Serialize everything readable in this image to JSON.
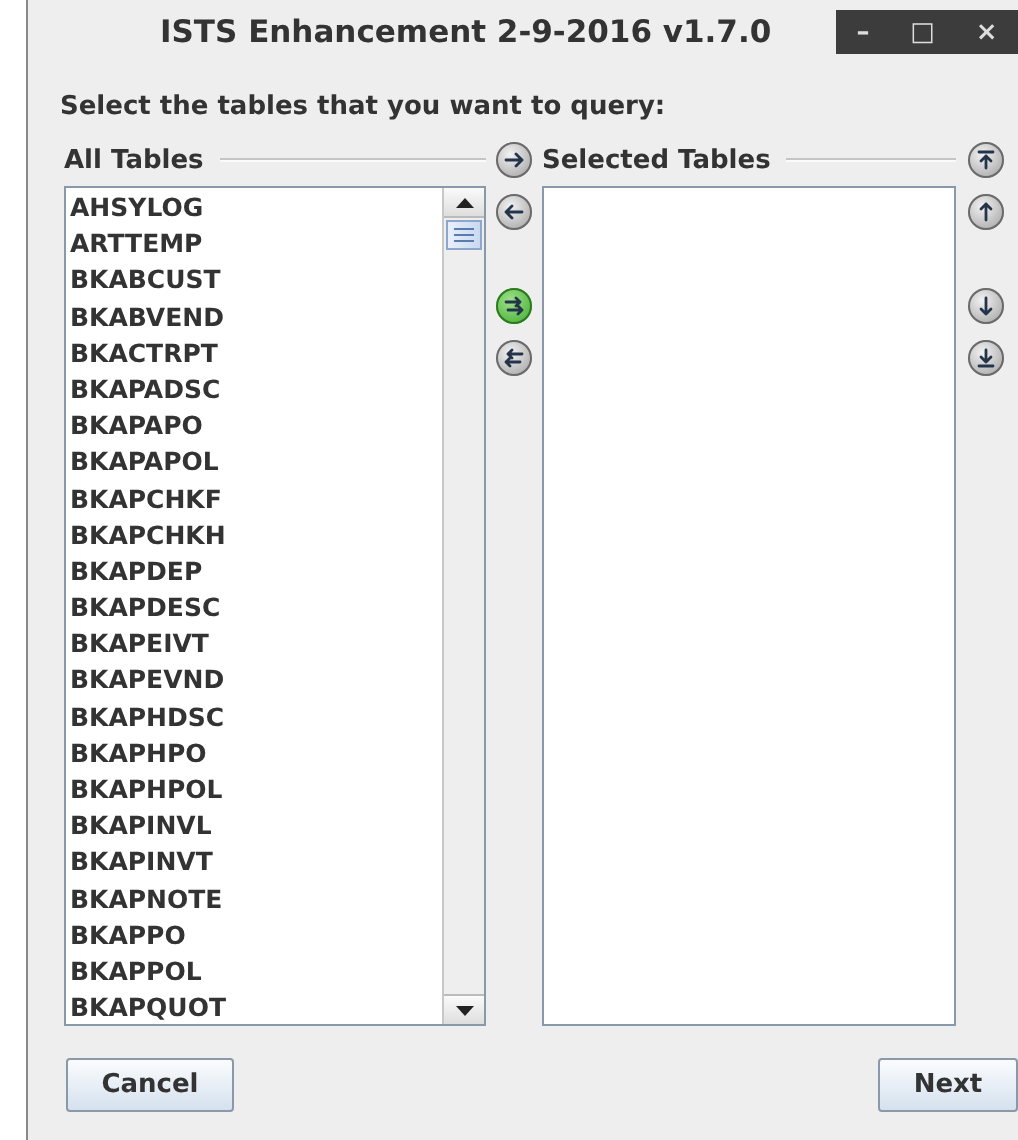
{
  "window": {
    "title": "ISTS Enhancement 2-9-2016 v1.7.0",
    "controls": [
      "–",
      "□",
      "×"
    ]
  },
  "prompt": "Select the tables that you want to query:",
  "all_tables": {
    "heading": "All Tables",
    "items": [
      "AHSYLOG",
      "ARTTEMP",
      "BKABCUST",
      "BKABVEND",
      "BKACTRPT",
      "BKAPADSC",
      "BKAPAPO",
      "BKAPAPOL",
      "BKAPCHKF",
      "BKAPCHKH",
      "BKAPDEP",
      "BKAPDESC",
      "BKAPEIVT",
      "BKAPEVND",
      "BKAPHDSC",
      "BKAPHPO",
      "BKAPHPOL",
      "BKAPINVL",
      "BKAPINVT",
      "BKAPNOTE",
      "BKAPPO",
      "BKAPPOL",
      "BKAPQUOT"
    ]
  },
  "move_buttons": [
    {
      "kind": "add",
      "highlighted": false
    },
    {
      "kind": "remove",
      "highlighted": false
    },
    {
      "kind": "add_all",
      "highlighted": true
    },
    {
      "kind": "remove_all",
      "highlighted": false
    }
  ],
  "selected_tables": {
    "heading": "Selected Tables"
  },
  "order_buttons": [
    {
      "kind": "top"
    },
    {
      "kind": "up"
    },
    {
      "kind": "down"
    },
    {
      "kind": "bottom"
    }
  ],
  "buttons": {
    "cancel": "Cancel",
    "next": "Next"
  }
}
